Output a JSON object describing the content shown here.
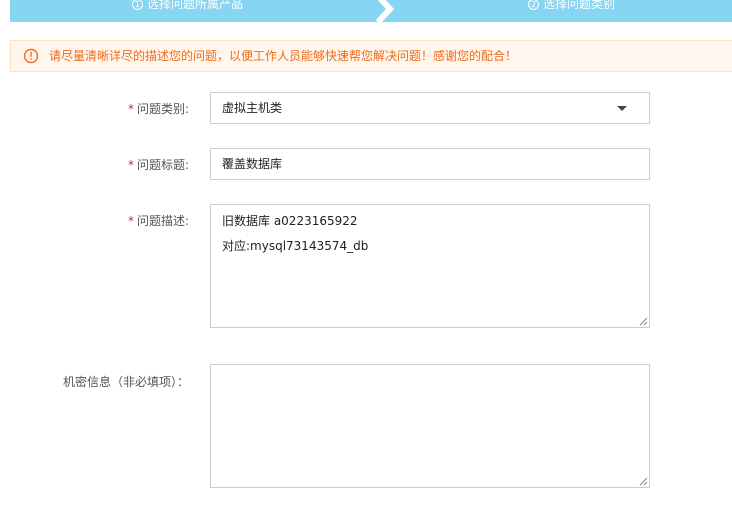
{
  "steps": [
    {
      "num": "1",
      "label": "选择问题所属产品"
    },
    {
      "num": "2",
      "label": "选择问题类别"
    }
  ],
  "notice": {
    "icon": "warning-circle-icon",
    "text": "请尽量清晰详尽的描述您的问题，以便工作人员能够快速帮您解决问题！感谢您的配合！",
    "color": "#ef6b1a"
  },
  "form": {
    "category": {
      "required_mark": "*",
      "label": "问题类别:",
      "value": "虚拟主机类"
    },
    "title": {
      "required_mark": "*",
      "label": "问题标题:",
      "value": "覆盖数据库"
    },
    "description": {
      "required_mark": "*",
      "label": "问题描述:",
      "lines": [
        "旧数据库 a0223165922",
        "对应:mysql73143574_db"
      ]
    },
    "secret": {
      "label": "机密信息（非必填项）：",
      "value": ""
    }
  },
  "colors": {
    "steps_bg": "#86d6f3",
    "notice_bg": "#fff6ed",
    "required": "#e02020"
  }
}
